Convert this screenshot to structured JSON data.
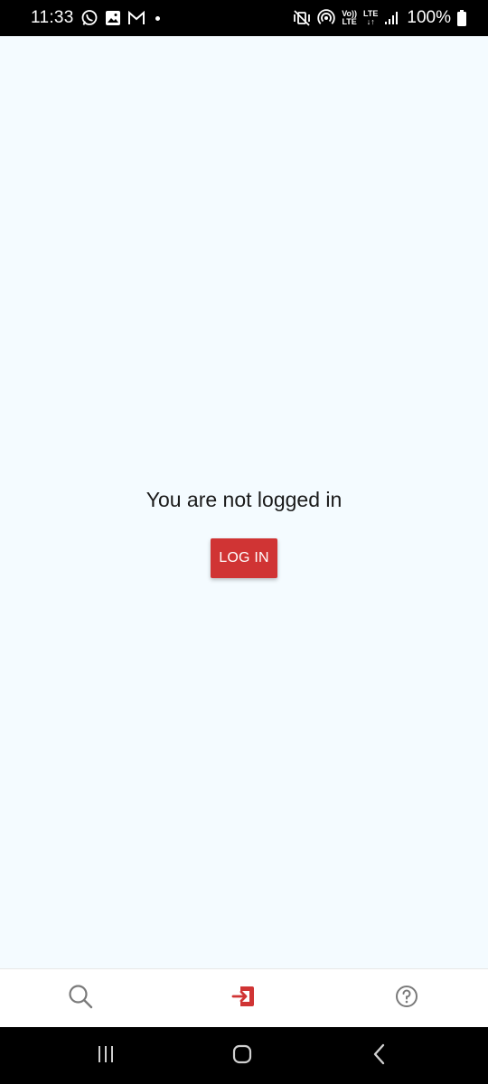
{
  "status_bar": {
    "time": "11:33",
    "notification_icons": [
      "whatsapp-icon",
      "gallery-icon",
      "gmail-icon",
      "more-dot-icon"
    ],
    "system_icons": [
      "mute-vibrate-icon",
      "hotspot-icon",
      "volte-icon",
      "lte-icon",
      "signal-icon"
    ],
    "volte_top": "Vo))",
    "volte_bottom": "LTE",
    "lte_top": "LTE",
    "lte_bottom": "↓↑",
    "battery": "100%"
  },
  "main": {
    "message": "You are not logged in",
    "login_label": "LOG IN"
  },
  "bottom_nav": {
    "items": [
      {
        "icon": "search-icon"
      },
      {
        "icon": "login-icon",
        "active": true
      },
      {
        "icon": "help-icon"
      }
    ]
  },
  "colors": {
    "accent": "#d03434",
    "background": "#f4fbff",
    "nav_icon": "#7a7a7a"
  }
}
